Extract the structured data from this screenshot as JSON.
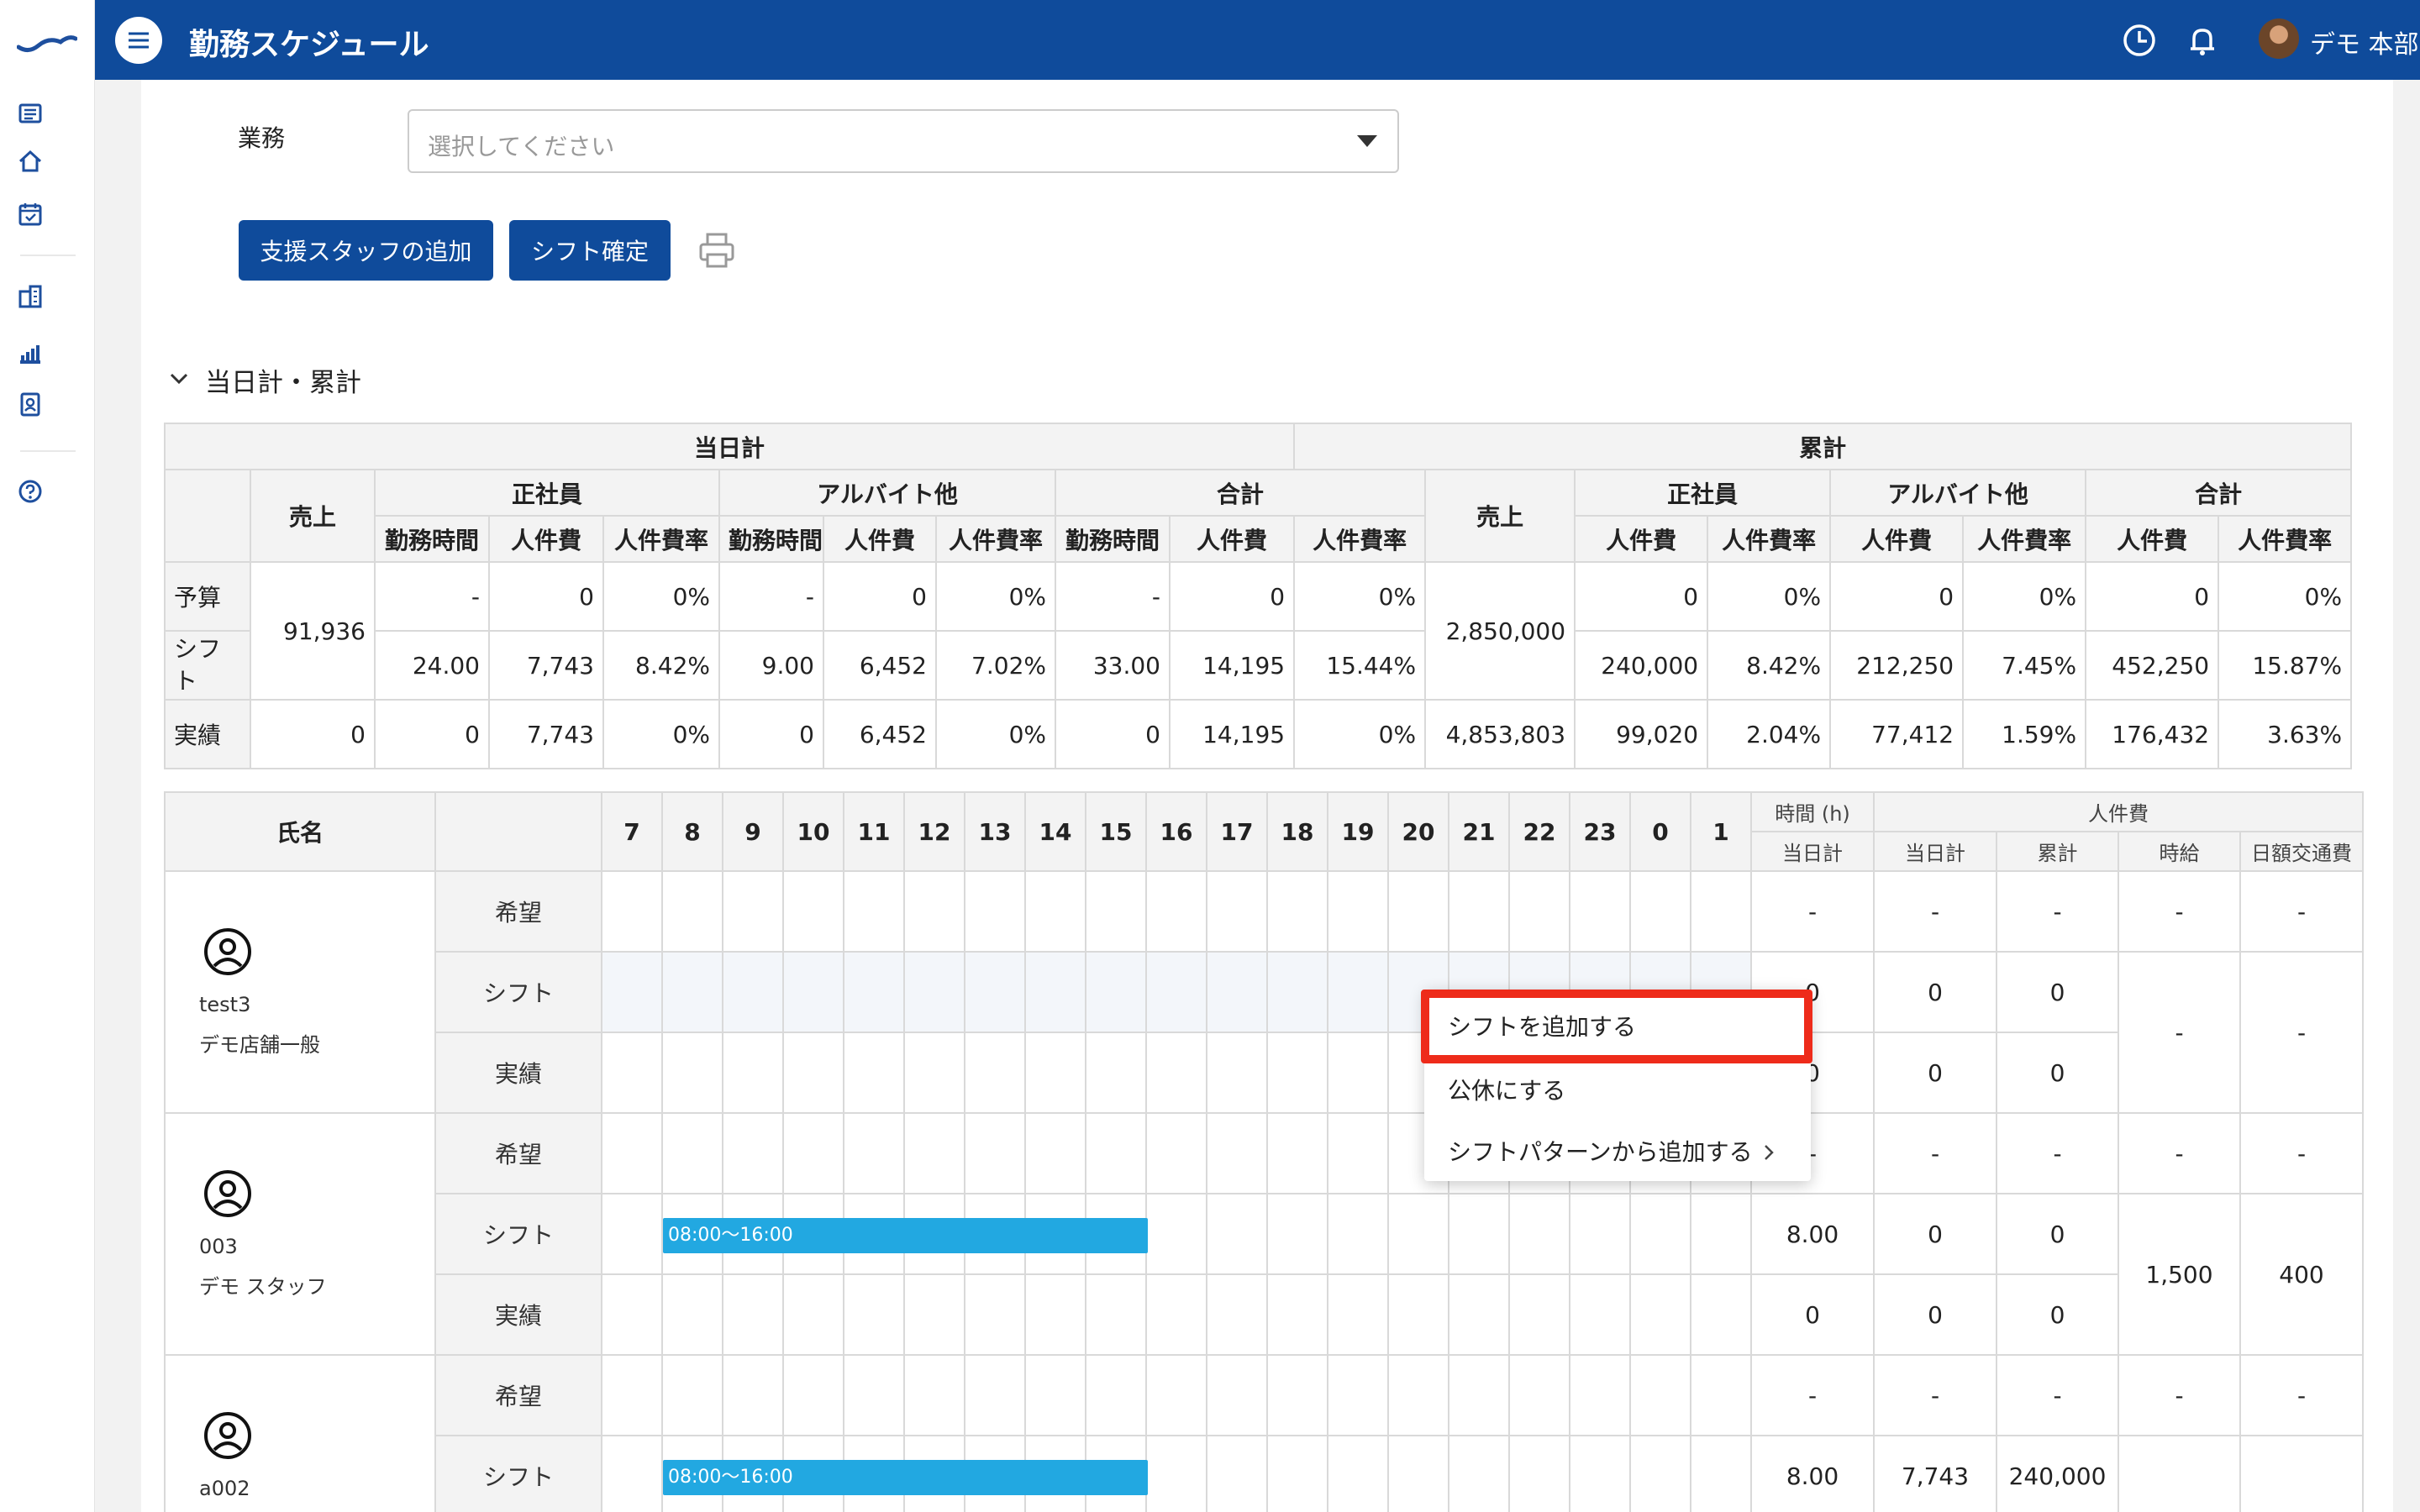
{
  "header": {
    "title": "勤務スケジュール",
    "user_name": "デモ 本部"
  },
  "form": {
    "business_label": "業務",
    "business_placeholder": "選択してください",
    "add_support_staff": "支援スタッフの追加",
    "confirm_shift": "シフト確定"
  },
  "section": {
    "title": "当日計・累計"
  },
  "summary": {
    "day_total": "当日計",
    "cumulative": "累計",
    "sales": "売上",
    "groups": {
      "full_time": "正社員",
      "part_time": "アルバイト他",
      "total": "合計"
    },
    "cols": {
      "hours": "勤務時間",
      "labor_cost": "人件費",
      "labor_ratio": "人件費率"
    },
    "rows": {
      "budget": "予算",
      "shift": "シフト",
      "actual": "実績"
    },
    "day_sales_shared": "91,936",
    "cum_sales_shared": "2,850,000",
    "budget": [
      "-",
      "0",
      "0%",
      "-",
      "0",
      "0%",
      "-",
      "0",
      "0%",
      "0",
      "0%",
      "0",
      "0%",
      "0",
      "0%"
    ],
    "shift": [
      "24.00",
      "7,743",
      "8.42%",
      "9.00",
      "6,452",
      "7.02%",
      "33.00",
      "14,195",
      "15.44%",
      "240,000",
      "8.42%",
      "212,250",
      "7.45%",
      "452,250",
      "15.87%"
    ],
    "actual": [
      "0",
      "0",
      "7,743",
      "0%",
      "0",
      "6,452",
      "0%",
      "0",
      "14,195",
      "0%",
      "4,853,803",
      "99,020",
      "2.04%",
      "77,412",
      "1.59%",
      "176,432",
      "3.63%"
    ]
  },
  "schedule": {
    "name_header": "氏名",
    "hours": [
      "7",
      "8",
      "9",
      "10",
      "11",
      "12",
      "13",
      "14",
      "15",
      "16",
      "17",
      "18",
      "19",
      "20",
      "21",
      "22",
      "23",
      "0",
      "1"
    ],
    "time_header": "時間 (h)",
    "labor_header": "人件費",
    "sub": {
      "day": "当日計",
      "day2": "当日計",
      "cum": "累計",
      "hourly": "時給",
      "daily_transport": "日額交通費"
    },
    "types": {
      "wish": "希望",
      "shift": "シフト",
      "actual": "実績"
    },
    "staff": [
      {
        "code": "test3",
        "store": "デモ店舗一般",
        "wish": [
          "-",
          "-",
          "-"
        ],
        "shift": [
          "0",
          "0",
          "0"
        ],
        "actual": [
          "0",
          "0",
          "0"
        ],
        "hourly": "-",
        "transport": "-"
      },
      {
        "code": "003",
        "store": "デモ スタッフ",
        "wish": [
          "-",
          "-",
          "-"
        ],
        "shift": [
          "8.00",
          "0",
          "0"
        ],
        "actual": [
          "0",
          "0",
          "0"
        ],
        "hourly": "1,500",
        "transport": "400",
        "shift_bar": "08:00〜16:00"
      },
      {
        "code": "a002",
        "store": "",
        "wish": [
          "-",
          "-",
          "-"
        ],
        "shift": [
          "8.00",
          "7,743",
          "240,000"
        ],
        "hourly": "-",
        "transport": "-",
        "shift_bar": "08:00〜16:00"
      }
    ]
  },
  "context_menu": {
    "add_shift": "シフトを追加する",
    "set_holiday": "公休にする",
    "add_from_pattern": "シフトパターンから追加する"
  }
}
